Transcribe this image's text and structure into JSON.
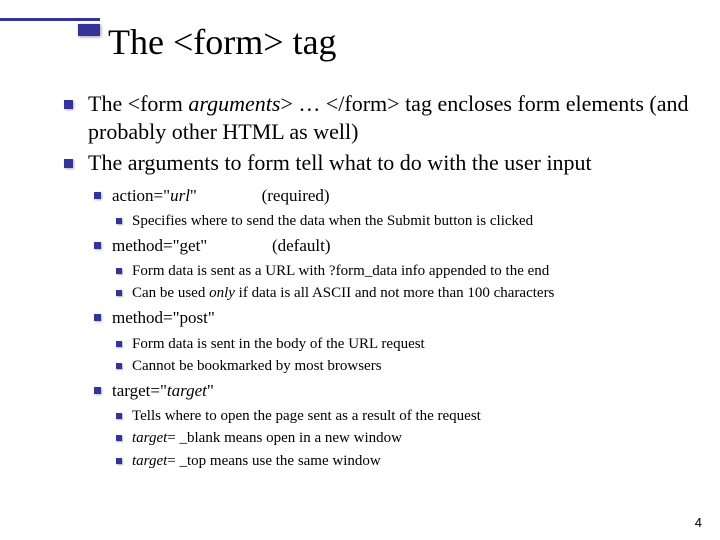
{
  "title_pre": "The ",
  "title_code": "<form>",
  "title_post": " tag",
  "p1_pre": "The ",
  "p1_code1": "<form ",
  "p1_args": "arguments",
  "p1_code2": "> … </form>",
  "p1_post": " tag encloses form elements (and probably other HTML as well)",
  "p2_pre": "The arguments to ",
  "p2_code": "form",
  "p2_post": " tell what to do with the user input",
  "a_action_code": "action=\"",
  "a_action_ital": "url",
  "a_action_close": "\"",
  "a_action_note": "(required)",
  "a_action_sub_pre": "Specifies where to send the data when the  ",
  "a_action_sub_code": "Submit",
  "a_action_sub_post": " button is clicked",
  "a_method_get_code": "method=\"get\"",
  "a_method_get_note": "(default)",
  "a_get_sub1_pre": "Form data is sent as a URL with ",
  "a_get_sub1_code": "?form_data",
  "a_get_sub1_post": " info appended to the end",
  "a_get_sub2_pre": "Can be used ",
  "a_get_sub2_ital": "only",
  "a_get_sub2_post": " if data is all ASCII and not more than 100 characters",
  "a_method_post_code": "method=\"post\"",
  "a_post_sub1": "Form data is sent in the body of the URL request",
  "a_post_sub2": "Cannot be bookmarked by most browsers",
  "a_target_code": "target=\"",
  "a_target_ital": "target",
  "a_target_close": "\"",
  "a_target_sub1": "Tells where to open the page sent as a result of the request",
  "a_target_sub2_ital": "target",
  "a_target_sub2_pre": "= ",
  "a_target_sub2_code": "_blank",
  "a_target_sub2_post": " means open in a new window",
  "a_target_sub3_ital": "target",
  "a_target_sub3_pre": "= ",
  "a_target_sub3_code": "_top",
  "a_target_sub3_post": " means use the same window",
  "page_number": "4"
}
